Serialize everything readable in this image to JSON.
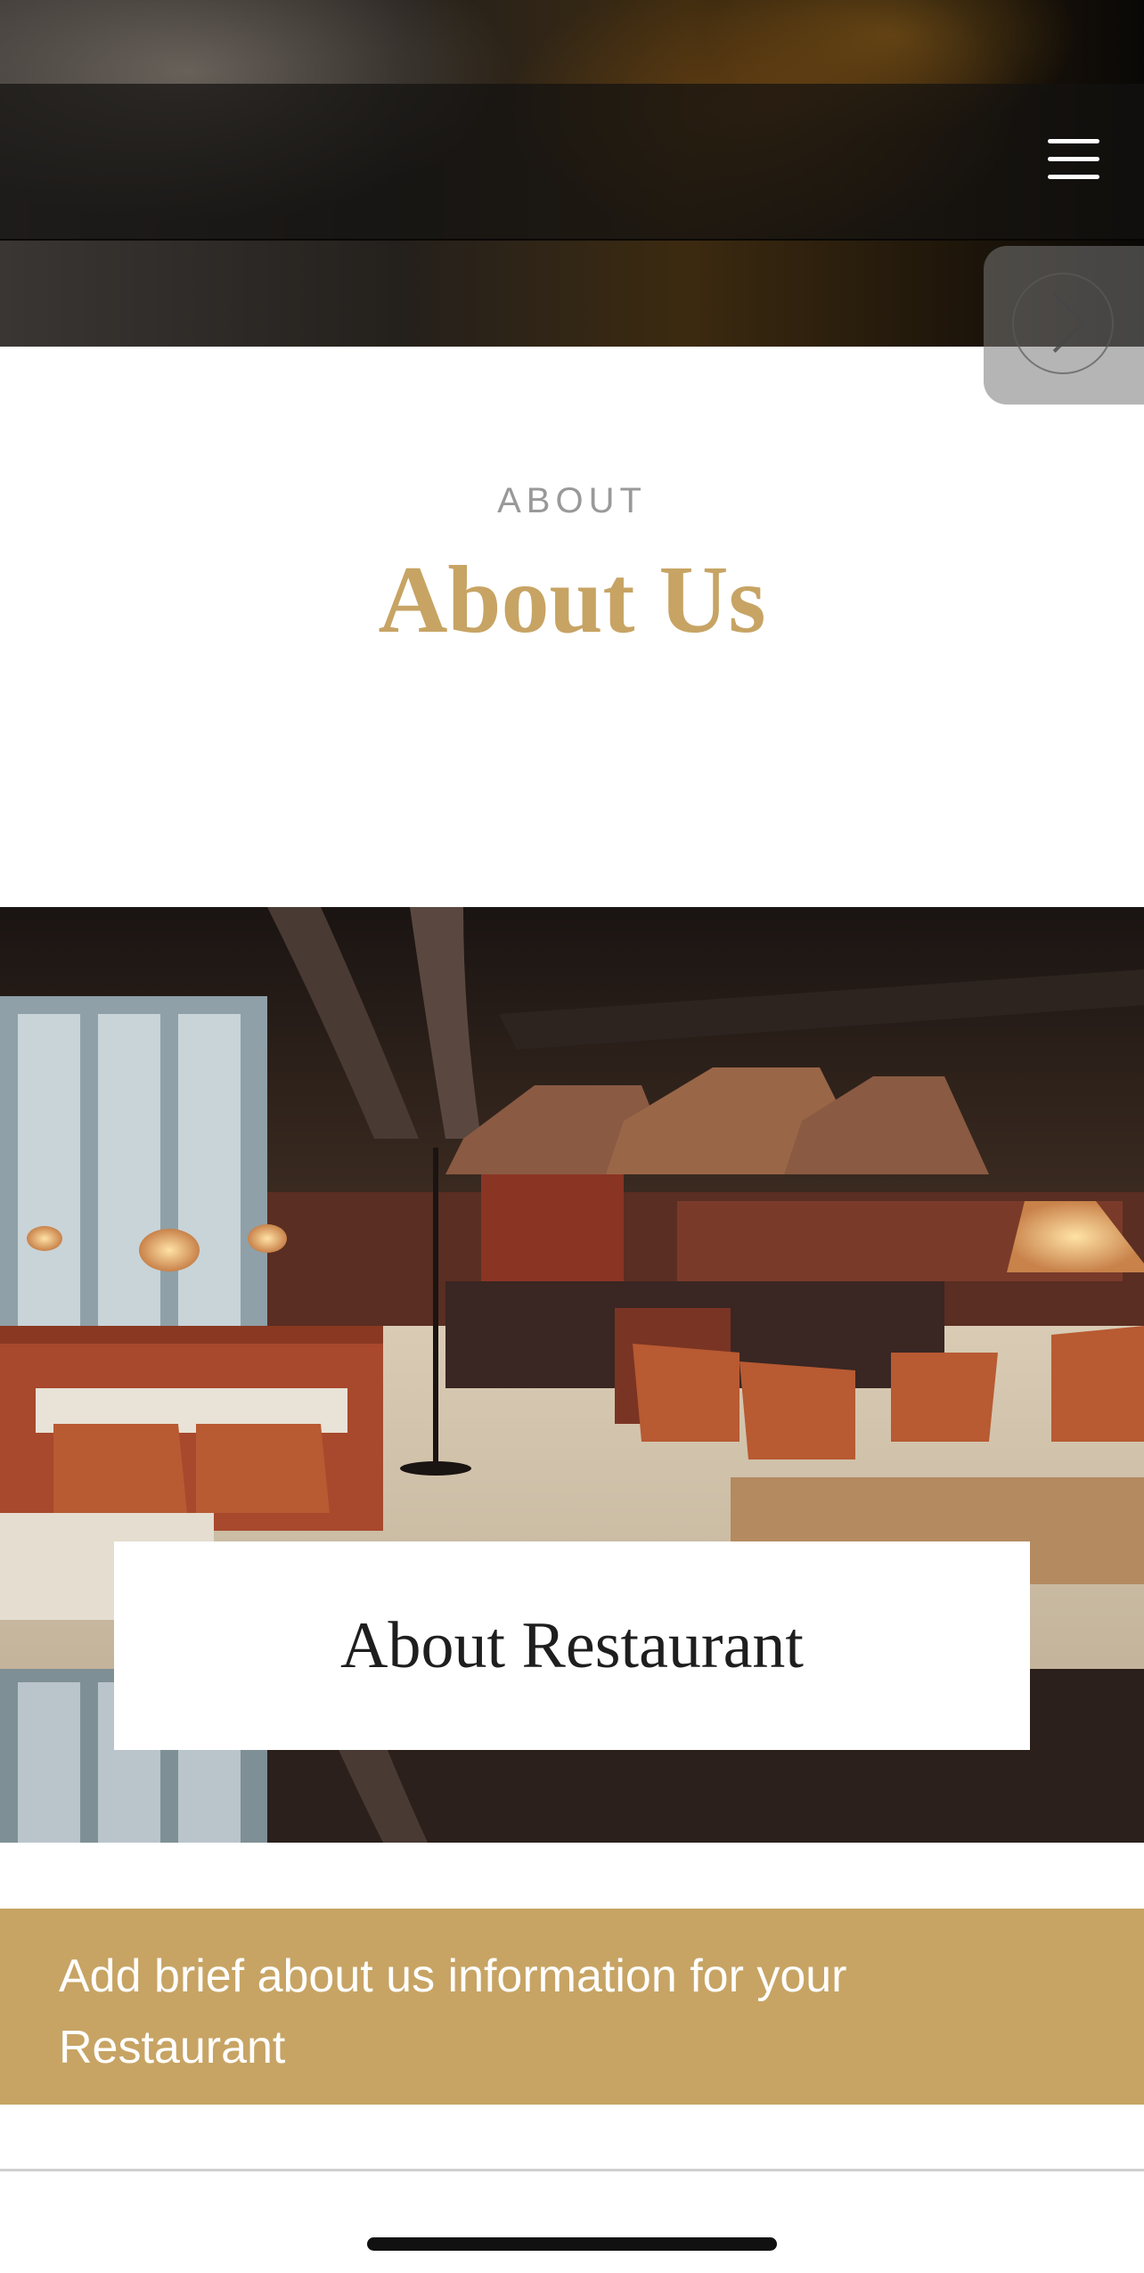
{
  "header": {
    "menu_icon": "hamburger-menu-icon",
    "next_icon": "chevron-right-icon"
  },
  "about": {
    "eyebrow": "ABOUT",
    "title": "About Us"
  },
  "restaurant_card": {
    "title": "About Restaurant"
  },
  "banner": {
    "text": "Add brief about us information for your Restaurant"
  },
  "colors": {
    "accent_gold": "#c7a464",
    "eyebrow_gray": "#999999",
    "card_text": "#1e1e1e"
  }
}
